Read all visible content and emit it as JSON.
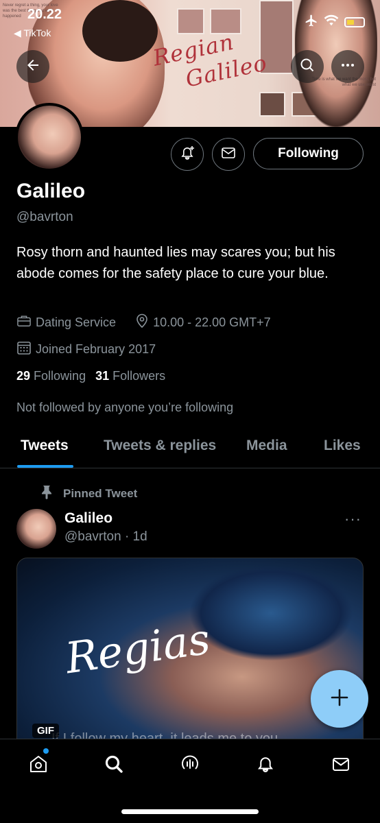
{
  "status_bar": {
    "time": "20.22",
    "back_app": "◀ TikTok"
  },
  "banner": {
    "script_line1": "Regian",
    "script_line2": "Galileo",
    "tiny_text_left": "Never regret a thing, your love was the best thing that ever happened",
    "tiny_text_right": "Time is what we want the most, but what we use worst"
  },
  "profile": {
    "name": "Galileo",
    "handle": "@bavrton",
    "bio": "Rosy thorn and haunted lies may scares you; but his abode comes for the safety place to cure your blue.",
    "category": "Dating Service",
    "location": "10.00 - 22.00 GMT+7",
    "joined": "Joined February 2017",
    "following_count": "29",
    "following_label": "Following",
    "followers_count": "31",
    "followers_label": "Followers",
    "not_followed": "Not followed by anyone you’re following",
    "follow_button": "Following"
  },
  "tabs": [
    {
      "label": "Tweets",
      "active": true
    },
    {
      "label": "Tweets & replies",
      "active": false
    },
    {
      "label": "Media",
      "active": false
    },
    {
      "label": "Likes",
      "active": false
    }
  ],
  "pinned_tweet": {
    "pinned_label": "Pinned Tweet",
    "author_name": "Galileo",
    "author_handle_time": "@bavrton · 1d",
    "more": "···",
    "media_script": "Regias",
    "media_caption": "If I follow my heart, it leads me to you",
    "media_badge": "GIF"
  },
  "colors": {
    "accent": "#1d9bf0",
    "fab": "#8ecdf8",
    "muted_text": "#8b949b",
    "border": "#2f3336"
  },
  "icons": [
    "back-arrow-icon",
    "search-icon",
    "more-icon",
    "notification-add-icon",
    "mail-icon",
    "briefcase-icon",
    "location-pin-icon",
    "calendar-icon",
    "pin-icon",
    "compose-plus-icon",
    "home-icon",
    "explore-search-icon",
    "spaces-icon",
    "bell-icon",
    "messages-icon"
  ]
}
